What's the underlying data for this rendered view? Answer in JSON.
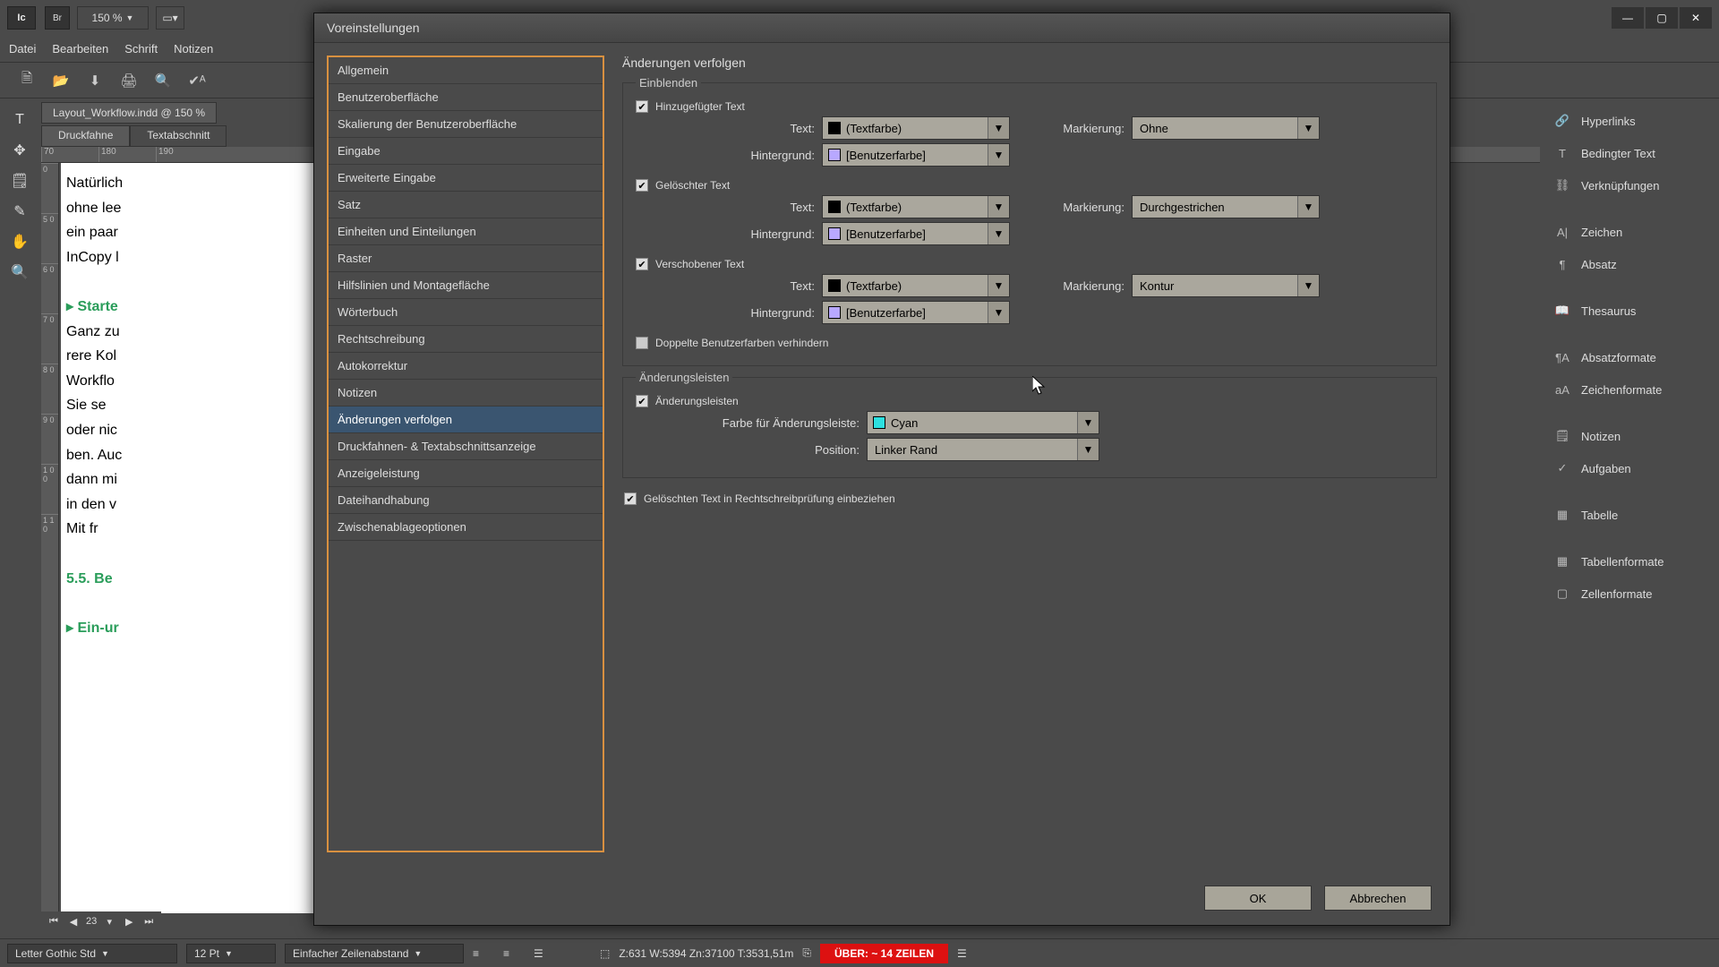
{
  "titlebar": {
    "app": "Ic",
    "bridge": "Br",
    "zoom": "150 %"
  },
  "menu": {
    "file": "Datei",
    "edit": "Bearbeiten",
    "font": "Schrift",
    "notes": "Notizen"
  },
  "document": {
    "tab": "Layout_Workflow.indd @ 150 %",
    "view_druckfahne": "Druckfahne",
    "view_textabschnitt": "Textabschnitt",
    "ruler_h": [
      "70",
      "180",
      "190"
    ],
    "ruler_v": [
      "0",
      "5 0",
      "6 0",
      "7 0",
      "8 0",
      "9 0",
      "1 0 0",
      "1 1 0"
    ],
    "lines": [
      "Natürlich",
      "ohne lee",
      "ein paar",
      "InCopy l",
      "",
      "▸  Starte",
      "Ganz zu",
      "rere Kol",
      "Workflo",
      "   Sie se",
      "oder nic",
      "ben. Auc",
      "dann mi",
      "in den v",
      "   Mit fr",
      "",
      "5.5.  Be",
      "",
      "▸  Ein-ur"
    ],
    "pager": "23"
  },
  "right_panels": [
    {
      "icon": "🔗",
      "label": "Hyperlinks",
      "name": "hyperlinks"
    },
    {
      "icon": "T",
      "label": "Bedingter Text",
      "name": "conditional-text"
    },
    {
      "icon": "⛓",
      "label": "Verknüpfungen",
      "name": "links"
    },
    {
      "gap": true
    },
    {
      "icon": "A|",
      "label": "Zeichen",
      "name": "character"
    },
    {
      "icon": "¶",
      "label": "Absatz",
      "name": "paragraph"
    },
    {
      "gap": true
    },
    {
      "icon": "📖",
      "label": "Thesaurus",
      "name": "thesaurus"
    },
    {
      "gap": true
    },
    {
      "icon": "¶A",
      "label": "Absatzformate",
      "name": "para-styles"
    },
    {
      "icon": "aA",
      "label": "Zeichenformate",
      "name": "char-styles"
    },
    {
      "gap": true
    },
    {
      "icon": "🗒",
      "label": "Notizen",
      "name": "notes"
    },
    {
      "icon": "✓",
      "label": "Aufgaben",
      "name": "tasks"
    },
    {
      "gap": true
    },
    {
      "icon": "▦",
      "label": "Tabelle",
      "name": "table"
    },
    {
      "gap": true
    },
    {
      "icon": "▦",
      "label": "Tabellenformate",
      "name": "table-styles"
    },
    {
      "icon": "▢",
      "label": "Zellenformate",
      "name": "cell-styles"
    }
  ],
  "statusbar": {
    "font": "Letter Gothic Std",
    "size": "12 Pt",
    "leading": "Einfacher Zeilenabstand",
    "coords": "Z:631     W:5394     Zn:37100   T:3531,51m",
    "overset": "ÜBER:  ~ 14 ZEILEN"
  },
  "dialog": {
    "title": "Voreinstellungen",
    "categories": [
      "Allgemein",
      "Benutzeroberfläche",
      "Skalierung der Benutzeroberfläche",
      "Eingabe",
      "Erweiterte Eingabe",
      "Satz",
      "Einheiten und Einteilungen",
      "Raster",
      "Hilfslinien und Montagefläche",
      "Wörterbuch",
      "Rechtschreibung",
      "Autokorrektur",
      "Notizen",
      "Änderungen verfolgen",
      "Druckfahnen- & Textabschnittsanzeige",
      "Anzeigeleistung",
      "Dateihandhabung",
      "Zwischenablageoptionen"
    ],
    "selected_category_index": 13,
    "heading": "Änderungen verfolgen",
    "einblenden": {
      "legend": "Einblenden",
      "added": {
        "check": "Hinzugefügter Text",
        "text_lbl": "Text:",
        "text_val": "(Textfarbe)",
        "bg_lbl": "Hintergrund:",
        "bg_val": "[Benutzerfarbe]",
        "mark_lbl": "Markierung:",
        "mark_val": "Ohne"
      },
      "deleted": {
        "check": "Gelöschter Text",
        "text_lbl": "Text:",
        "text_val": "(Textfarbe)",
        "bg_lbl": "Hintergrund:",
        "bg_val": "[Benutzerfarbe]",
        "mark_lbl": "Markierung:",
        "mark_val": "Durchgestrichen"
      },
      "moved": {
        "check": "Verschobener Text",
        "text_lbl": "Text:",
        "text_val": "(Textfarbe)",
        "bg_lbl": "Hintergrund:",
        "bg_val": "[Benutzerfarbe]",
        "mark_lbl": "Markierung:",
        "mark_val": "Kontur"
      },
      "prevent_dup": "Doppelte Benutzerfarben verhindern"
    },
    "changebars": {
      "legend": "Änderungsleisten",
      "check": "Änderungsleisten",
      "color_lbl": "Farbe für Änderungsleiste:",
      "color_val": "Cyan",
      "pos_lbl": "Position:",
      "pos_val": "Linker Rand"
    },
    "spellcheck_deleted": "Gelöschten Text in Rechtschreibprüfung einbeziehen",
    "ok": "OK",
    "cancel": "Abbrechen"
  }
}
